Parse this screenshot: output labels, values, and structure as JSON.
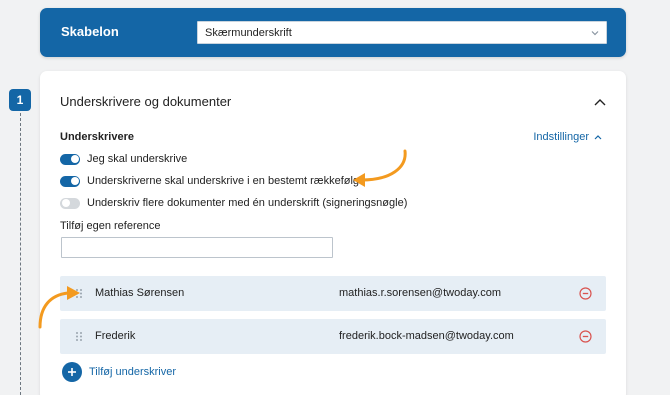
{
  "template": {
    "label": "Skabelon",
    "selected": "Skærmunderskrift"
  },
  "step": {
    "number": "1"
  },
  "card": {
    "title": "Underskrivere og dokumenter",
    "section_label": "Underskrivere",
    "settings_link": "Indstillinger",
    "toggles": [
      {
        "label": "Jeg skal underskrive",
        "on": true
      },
      {
        "label": "Underskriverne skal underskrive i en bestemt rækkefølge",
        "on": true
      },
      {
        "label": "Underskriv flere dokumenter med én underskrift (signeringsnøgle)",
        "on": false
      }
    ],
    "reference": {
      "label": "Tilføj egen reference",
      "value": ""
    },
    "signers": [
      {
        "name": "Mathias Sørensen",
        "email": "mathias.r.sorensen@twoday.com"
      },
      {
        "name": "Frederik",
        "email": "frederik.bock-madsen@twoday.com"
      }
    ],
    "add_signer_label": "Tilføj underskriver"
  },
  "colors": {
    "brand_blue": "#1466a6",
    "annotation_orange": "#f39a1f",
    "remove_red": "#d9534f",
    "signer_row_bg": "#e6eef5"
  }
}
